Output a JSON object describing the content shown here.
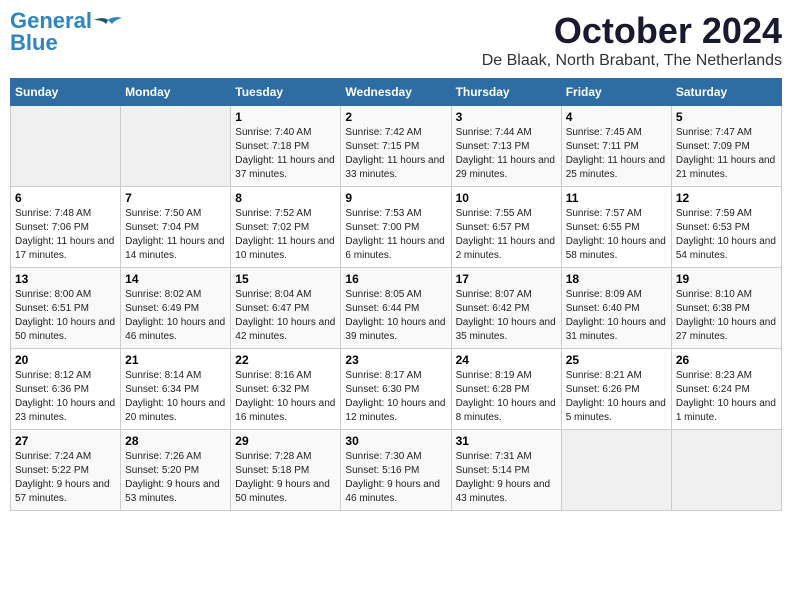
{
  "header": {
    "logo_line1": "General",
    "logo_line2": "Blue",
    "month": "October 2024",
    "location": "De Blaak, North Brabant, The Netherlands"
  },
  "weekdays": [
    "Sunday",
    "Monday",
    "Tuesday",
    "Wednesday",
    "Thursday",
    "Friday",
    "Saturday"
  ],
  "weeks": [
    [
      {
        "num": "",
        "empty": true
      },
      {
        "num": "",
        "empty": true
      },
      {
        "num": "1",
        "sunrise": "7:40 AM",
        "sunset": "7:18 PM",
        "daylight": "11 hours and 37 minutes."
      },
      {
        "num": "2",
        "sunrise": "7:42 AM",
        "sunset": "7:15 PM",
        "daylight": "11 hours and 33 minutes."
      },
      {
        "num": "3",
        "sunrise": "7:44 AM",
        "sunset": "7:13 PM",
        "daylight": "11 hours and 29 minutes."
      },
      {
        "num": "4",
        "sunrise": "7:45 AM",
        "sunset": "7:11 PM",
        "daylight": "11 hours and 25 minutes."
      },
      {
        "num": "5",
        "sunrise": "7:47 AM",
        "sunset": "7:09 PM",
        "daylight": "11 hours and 21 minutes."
      }
    ],
    [
      {
        "num": "6",
        "sunrise": "7:48 AM",
        "sunset": "7:06 PM",
        "daylight": "11 hours and 17 minutes."
      },
      {
        "num": "7",
        "sunrise": "7:50 AM",
        "sunset": "7:04 PM",
        "daylight": "11 hours and 14 minutes."
      },
      {
        "num": "8",
        "sunrise": "7:52 AM",
        "sunset": "7:02 PM",
        "daylight": "11 hours and 10 minutes."
      },
      {
        "num": "9",
        "sunrise": "7:53 AM",
        "sunset": "7:00 PM",
        "daylight": "11 hours and 6 minutes."
      },
      {
        "num": "10",
        "sunrise": "7:55 AM",
        "sunset": "6:57 PM",
        "daylight": "11 hours and 2 minutes."
      },
      {
        "num": "11",
        "sunrise": "7:57 AM",
        "sunset": "6:55 PM",
        "daylight": "10 hours and 58 minutes."
      },
      {
        "num": "12",
        "sunrise": "7:59 AM",
        "sunset": "6:53 PM",
        "daylight": "10 hours and 54 minutes."
      }
    ],
    [
      {
        "num": "13",
        "sunrise": "8:00 AM",
        "sunset": "6:51 PM",
        "daylight": "10 hours and 50 minutes."
      },
      {
        "num": "14",
        "sunrise": "8:02 AM",
        "sunset": "6:49 PM",
        "daylight": "10 hours and 46 minutes."
      },
      {
        "num": "15",
        "sunrise": "8:04 AM",
        "sunset": "6:47 PM",
        "daylight": "10 hours and 42 minutes."
      },
      {
        "num": "16",
        "sunrise": "8:05 AM",
        "sunset": "6:44 PM",
        "daylight": "10 hours and 39 minutes."
      },
      {
        "num": "17",
        "sunrise": "8:07 AM",
        "sunset": "6:42 PM",
        "daylight": "10 hours and 35 minutes."
      },
      {
        "num": "18",
        "sunrise": "8:09 AM",
        "sunset": "6:40 PM",
        "daylight": "10 hours and 31 minutes."
      },
      {
        "num": "19",
        "sunrise": "8:10 AM",
        "sunset": "6:38 PM",
        "daylight": "10 hours and 27 minutes."
      }
    ],
    [
      {
        "num": "20",
        "sunrise": "8:12 AM",
        "sunset": "6:36 PM",
        "daylight": "10 hours and 23 minutes."
      },
      {
        "num": "21",
        "sunrise": "8:14 AM",
        "sunset": "6:34 PM",
        "daylight": "10 hours and 20 minutes."
      },
      {
        "num": "22",
        "sunrise": "8:16 AM",
        "sunset": "6:32 PM",
        "daylight": "10 hours and 16 minutes."
      },
      {
        "num": "23",
        "sunrise": "8:17 AM",
        "sunset": "6:30 PM",
        "daylight": "10 hours and 12 minutes."
      },
      {
        "num": "24",
        "sunrise": "8:19 AM",
        "sunset": "6:28 PM",
        "daylight": "10 hours and 8 minutes."
      },
      {
        "num": "25",
        "sunrise": "8:21 AM",
        "sunset": "6:26 PM",
        "daylight": "10 hours and 5 minutes."
      },
      {
        "num": "26",
        "sunrise": "8:23 AM",
        "sunset": "6:24 PM",
        "daylight": "10 hours and 1 minute."
      }
    ],
    [
      {
        "num": "27",
        "sunrise": "7:24 AM",
        "sunset": "5:22 PM",
        "daylight": "9 hours and 57 minutes."
      },
      {
        "num": "28",
        "sunrise": "7:26 AM",
        "sunset": "5:20 PM",
        "daylight": "9 hours and 53 minutes."
      },
      {
        "num": "29",
        "sunrise": "7:28 AM",
        "sunset": "5:18 PM",
        "daylight": "9 hours and 50 minutes."
      },
      {
        "num": "30",
        "sunrise": "7:30 AM",
        "sunset": "5:16 PM",
        "daylight": "9 hours and 46 minutes."
      },
      {
        "num": "31",
        "sunrise": "7:31 AM",
        "sunset": "5:14 PM",
        "daylight": "9 hours and 43 minutes."
      },
      {
        "num": "",
        "empty": true
      },
      {
        "num": "",
        "empty": true
      }
    ]
  ]
}
